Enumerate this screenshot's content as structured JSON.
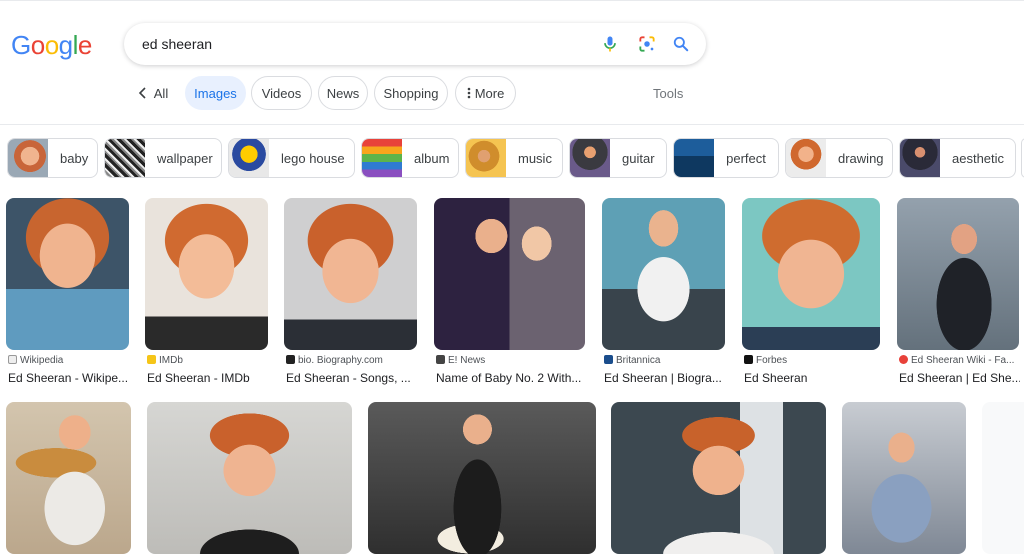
{
  "search": {
    "query": "ed sheeran",
    "logo_letters": [
      "G",
      "o",
      "o",
      "g",
      "l",
      "e"
    ],
    "logo_colors": [
      "#4285f4",
      "#ea4335",
      "#fbbc05",
      "#4285f4",
      "#34a853",
      "#ea4335"
    ]
  },
  "tabs": {
    "back_icon": "chevron-left-icon",
    "all": "All",
    "images": "Images",
    "videos": "Videos",
    "news": "News",
    "shopping": "Shopping",
    "more": "More",
    "tools": "Tools"
  },
  "chips": [
    {
      "label": "baby"
    },
    {
      "label": "wallpaper"
    },
    {
      "label": "lego house"
    },
    {
      "label": "album"
    },
    {
      "label": "music"
    },
    {
      "label": "guitar"
    },
    {
      "label": "perfect"
    },
    {
      "label": "drawing"
    },
    {
      "label": "aesthetic"
    }
  ],
  "results_row1": [
    {
      "source": "Wikipedia",
      "title": "Ed Sheeran - Wikipe..."
    },
    {
      "source": "IMDb",
      "title": "Ed Sheeran - IMDb"
    },
    {
      "source": "bio. Biography.com",
      "title": "Ed Sheeran - Songs, ..."
    },
    {
      "source": "E! News",
      "title": "Name of Baby No. 2 With..."
    },
    {
      "source": "Britannica",
      "title": "Ed Sheeran | Biogra..."
    },
    {
      "source": "Forbes",
      "title": "Ed Sheeran"
    },
    {
      "source": "Ed Sheeran Wiki - Fa...",
      "title": "Ed Sheeran | Ed She..."
    }
  ],
  "colors": {
    "accent": "#1a73e8",
    "active_tab_bg": "#e8f0fe",
    "border": "#dadce0"
  }
}
